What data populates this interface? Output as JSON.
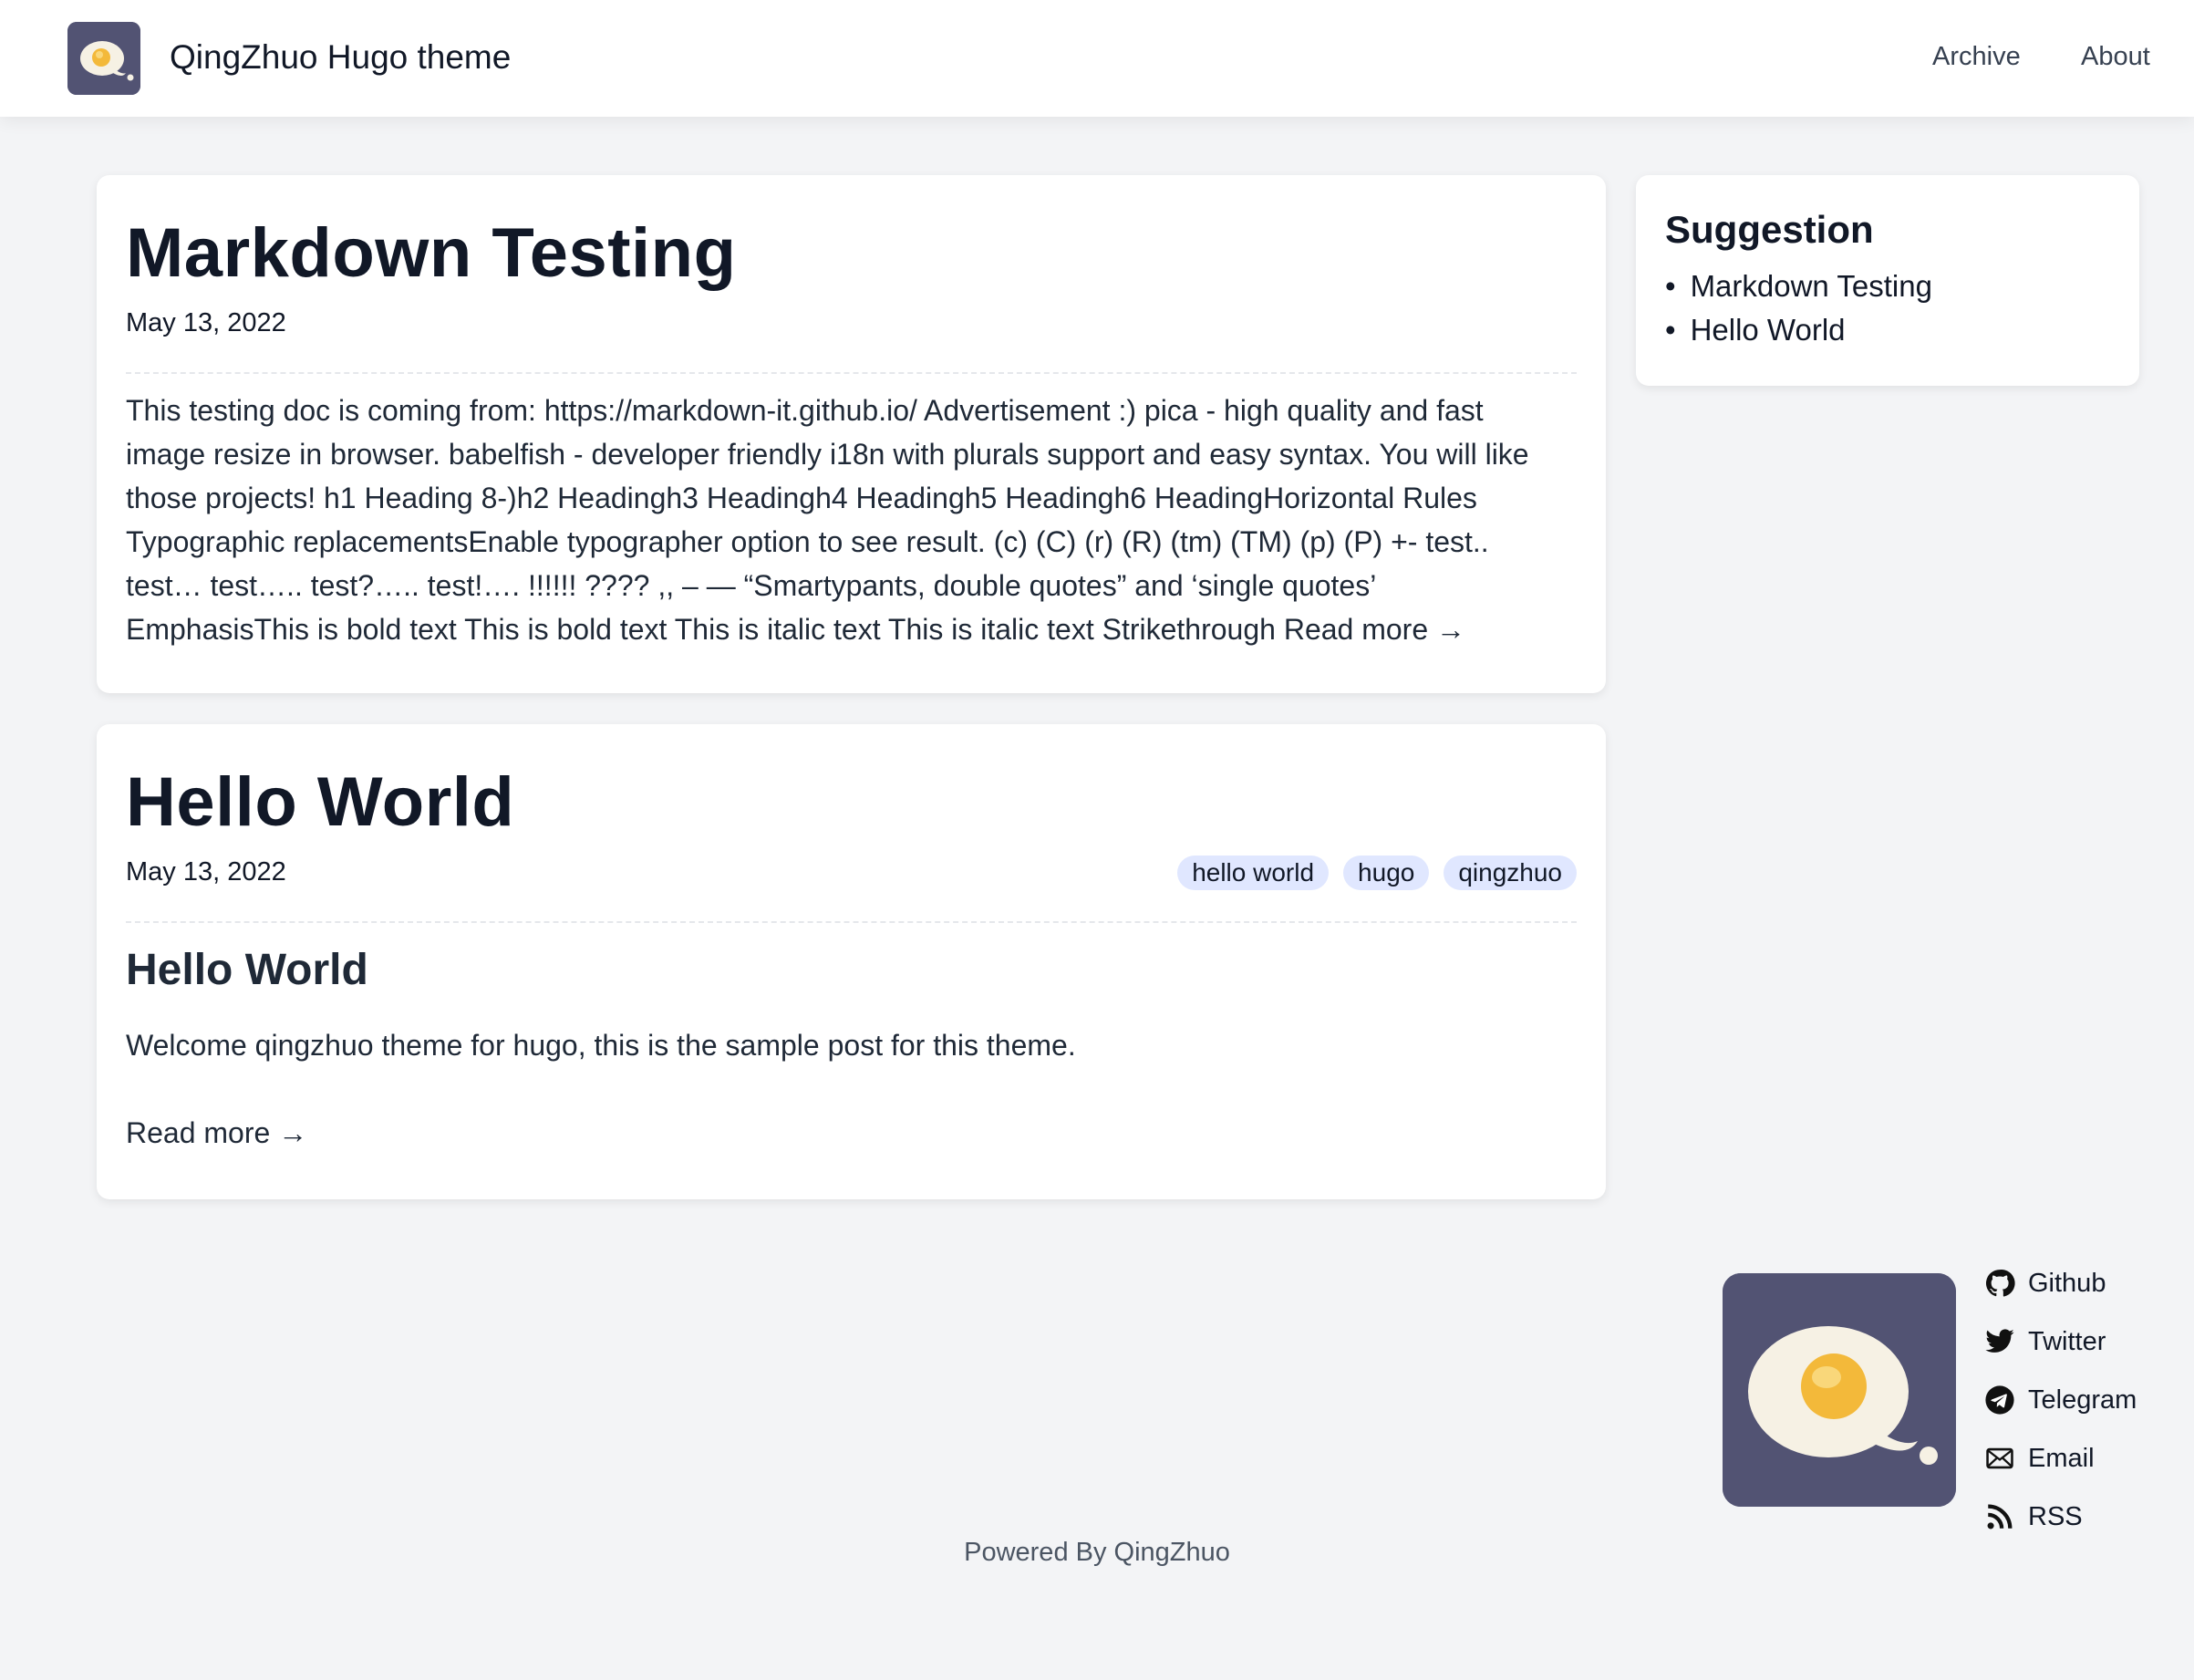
{
  "header": {
    "site_title": "QingZhuo Hugo theme",
    "nav": [
      {
        "label": "Archive"
      },
      {
        "label": "About"
      }
    ]
  },
  "posts": [
    {
      "title": "Markdown Testing",
      "date": "May 13, 2022",
      "excerpt": "This testing doc is coming from: https://markdown-it.github.io/ Advertisement :) pica - high quality and fast image resize in browser. babelfish - developer friendly i18n with plurals support and easy syntax. You will like those projects! h1 Heading 8-)h2 Headingh3 Headingh4 Headingh5 Headingh6 HeadingHorizontal Rules Typographic replacementsEnable typographer option to see result. (c) (C) (r) (R) (tm) (TM) (p) (P) +- test.. test… test….. test?….. test!…. !!!!!! ???? ,, – — “Smartypants, double quotes” and ‘single quotes’ EmphasisThis is bold text This is bold text This is italic text This is italic text Strikethrough",
      "read_more": "Read more →"
    },
    {
      "title": "Hello World",
      "date": "May 13, 2022",
      "tags": [
        "hello world",
        "hugo",
        "qingzhuo"
      ],
      "content_heading": "Hello World",
      "content_text": "Welcome qingzhuo theme for hugo, this is the sample post for this theme.",
      "read_more": "Read more →"
    }
  ],
  "sidebar": {
    "title": "Suggestion",
    "items": [
      {
        "label": "Markdown Testing"
      },
      {
        "label": "Hello World"
      }
    ]
  },
  "social": [
    {
      "label": "Github",
      "icon": "github-icon"
    },
    {
      "label": "Twitter",
      "icon": "twitter-icon"
    },
    {
      "label": "Telegram",
      "icon": "telegram-icon"
    },
    {
      "label": "Email",
      "icon": "email-icon"
    },
    {
      "label": "RSS",
      "icon": "rss-icon"
    }
  ],
  "footer": {
    "text": "Powered By QingZhuo"
  },
  "colors": {
    "page_bg": "#f3f4f6",
    "logo_bg": "#525373",
    "tag_bg": "#e0e7ff",
    "egg_yolk": "#f5c044"
  }
}
